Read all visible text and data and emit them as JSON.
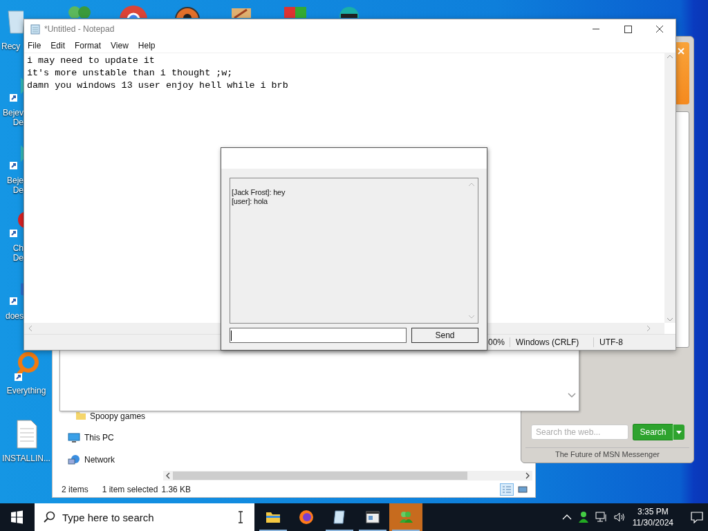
{
  "desktop": {
    "top_icons": [
      {
        "kind": "people"
      },
      {
        "kind": "browser"
      },
      {
        "kind": "game"
      },
      {
        "kind": "tools"
      },
      {
        "kind": "shield"
      },
      {
        "kind": "character"
      }
    ],
    "left_icons": [
      {
        "kind": "bin",
        "label": [
          "Recy"
        ]
      },
      {
        "kind": "gem",
        "label": [
          "Bejev",
          "De"
        ]
      },
      {
        "kind": "gem2",
        "label": [
          "Beje",
          "De"
        ]
      },
      {
        "kind": "red",
        "label": [
          "Ch",
          "De"
        ]
      },
      {
        "kind": "swirl",
        "label": [
          "does"
        ]
      },
      {
        "kind": "search",
        "label": [
          "Everything"
        ]
      },
      {
        "kind": "file",
        "label": [
          "INSTALLIN..."
        ]
      }
    ]
  },
  "explorer": {
    "nav_items": [
      {
        "kind": "folder",
        "label": "Spoopy games"
      },
      {
        "kind": "pc",
        "label": "This PC"
      },
      {
        "kind": "network",
        "label": "Network"
      }
    ],
    "status": [
      "2 items",
      "1 item selected",
      "1.36 KB"
    ],
    "views": [
      {
        "kind": "details",
        "selected": true
      },
      {
        "kind": "tiles",
        "selected": false
      }
    ]
  },
  "msn": {
    "search_placeholder": "Search the web...",
    "search_button": "Search",
    "footer": "The Future of MSN Messenger"
  },
  "notepad": {
    "title": "*Untitled - Notepad",
    "menu": [
      "File",
      "Edit",
      "Format",
      "View",
      "Help"
    ],
    "lines": [
      "i may need to update it",
      "it's more unstable than i thought ;w;",
      "damn you windows 13 user enjoy hell while i brb"
    ],
    "status": [
      "00%",
      "Windows (CRLF)",
      "UTF-8"
    ]
  },
  "chat": {
    "messages": [
      "[Jack Frost]: hey",
      "[user]: hola"
    ],
    "send_button": "Send"
  },
  "taskbar": {
    "search_placeholder": "Type here to search",
    "apps": [
      {
        "kind": "folder",
        "running": true,
        "selected": false
      },
      {
        "kind": "firefox",
        "running": false,
        "selected": false
      },
      {
        "kind": "notepad",
        "running": true,
        "selected": false
      },
      {
        "kind": "window",
        "running": true,
        "selected": false
      },
      {
        "kind": "msn",
        "running": true,
        "selected": true
      }
    ],
    "time": "3:35 PM",
    "date": "11/30/2024"
  }
}
